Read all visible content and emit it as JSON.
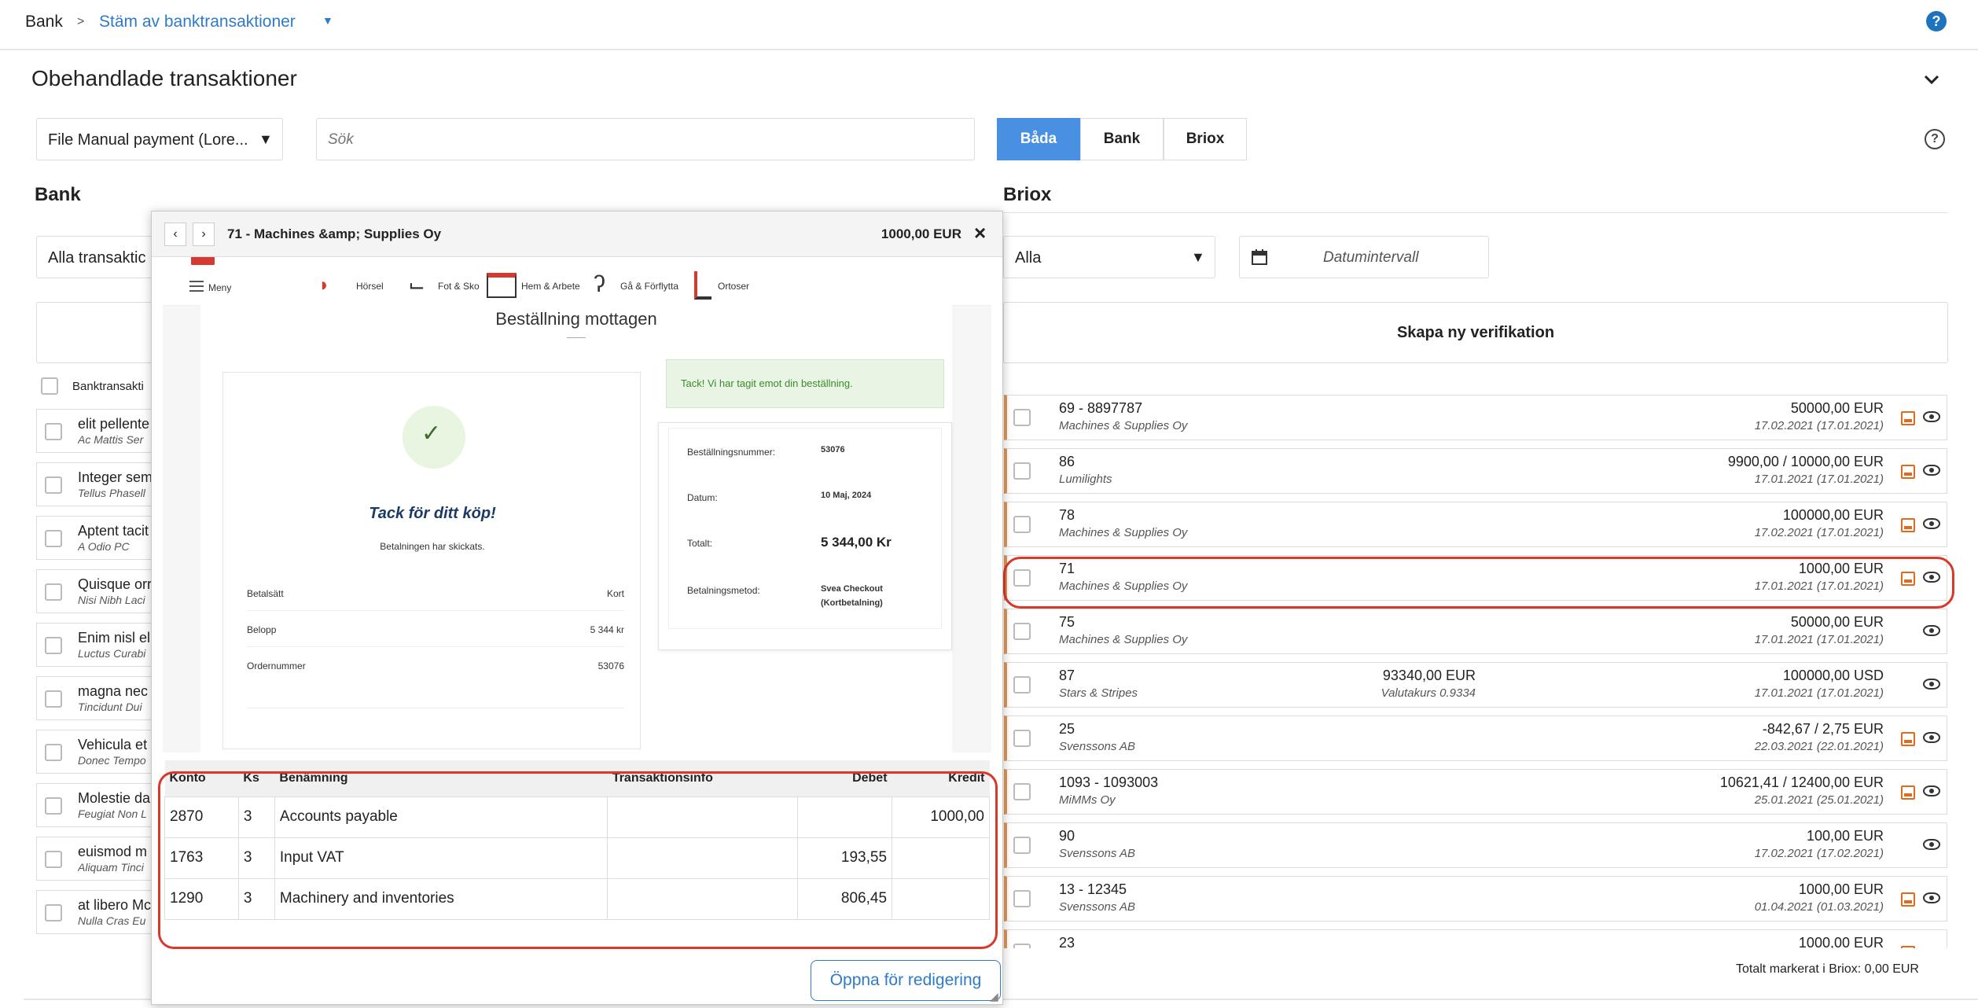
{
  "breadcrumb": {
    "root": "Bank",
    "separator": ">",
    "current": "Stäm av banktransaktioner"
  },
  "section": {
    "title": "Obehandlade transaktioner"
  },
  "filter": {
    "file_value": "File Manual payment (Lore...",
    "search_placeholder": "Sök"
  },
  "segments": [
    {
      "label": "Båda",
      "active": true
    },
    {
      "label": "Bank",
      "active": false
    },
    {
      "label": "Briox",
      "active": false
    }
  ],
  "bank": {
    "title": "Bank",
    "filter_value": "Alla transaktic",
    "column_header": "Banktransakti",
    "rows": [
      {
        "title": "elit pellente",
        "sub": "Ac Mattis Ser"
      },
      {
        "title": "Integer sem",
        "sub": "Tellus Phasell"
      },
      {
        "title": "Aptent tacit",
        "sub": "A Odio PC"
      },
      {
        "title": "Quisque orr",
        "sub": "Nisi Nibh Laci"
      },
      {
        "title": "Enim nisl el",
        "sub": "Luctus Curabi"
      },
      {
        "title": "magna nec",
        "sub": "Tincidunt Dui"
      },
      {
        "title": "Vehicula et",
        "sub": "Donec Tempo"
      },
      {
        "title": "Molestie da",
        "sub": "Feugiat Non L"
      },
      {
        "title": "euismod m",
        "sub": "Aliquam Tinci"
      },
      {
        "title": "at libero Mc",
        "sub": "Nulla Cras Eu"
      }
    ]
  },
  "briox": {
    "title": "Briox",
    "filter_value": "Alla",
    "date_placeholder": "Datumintervall",
    "create_button": "Skapa ny verifikation",
    "total_label": "Totalt markerat i Briox: 0,00 EUR",
    "rows": [
      {
        "title": "69 - 8897787",
        "sub": "Machines & Supplies Oy",
        "amount": "50000,00 EUR",
        "date": "17.02.2021 (17.01.2021)",
        "mid_amount": "",
        "mid_sub": "",
        "has_image": true
      },
      {
        "title": "86",
        "sub": "Lumilights",
        "amount": "9900,00 / 10000,00 EUR",
        "date": "17.01.2021 (17.01.2021)",
        "mid_amount": "",
        "mid_sub": "",
        "has_image": true
      },
      {
        "title": "78",
        "sub": "Machines & Supplies Oy",
        "amount": "100000,00 EUR",
        "date": "17.02.2021 (17.01.2021)",
        "mid_amount": "",
        "mid_sub": "",
        "has_image": true
      },
      {
        "title": "71",
        "sub": "Machines & Supplies Oy",
        "amount": "1000,00 EUR",
        "date": "17.01.2021 (17.01.2021)",
        "mid_amount": "",
        "mid_sub": "",
        "has_image": true
      },
      {
        "title": "75",
        "sub": "Machines & Supplies Oy",
        "amount": "50000,00 EUR",
        "date": "17.01.2021 (17.01.2021)",
        "mid_amount": "",
        "mid_sub": "",
        "has_image": false
      },
      {
        "title": "87",
        "sub": "Stars & Stripes",
        "amount": "100000,00 USD",
        "date": "17.01.2021 (17.01.2021)",
        "mid_amount": "93340,00 EUR",
        "mid_sub": "Valutakurs 0.9334",
        "has_image": true
      },
      {
        "title": "25",
        "sub": "Svenssons AB",
        "amount": "-842,67 / 2,75 EUR",
        "date": "22.03.2021 (22.01.2021)",
        "mid_amount": "",
        "mid_sub": "",
        "has_image": true
      },
      {
        "title": "1093 - 1093003",
        "sub": "MiMMs Oy",
        "amount": "10621,41 / 12400,00 EUR",
        "date": "25.01.2021 (25.01.2021)",
        "mid_amount": "",
        "mid_sub": "",
        "has_image": true
      },
      {
        "title": "90",
        "sub": "Svenssons AB",
        "amount": "100,00 EUR",
        "date": "17.02.2021 (17.02.2021)",
        "mid_amount": "",
        "mid_sub": "",
        "has_image": false
      },
      {
        "title": "13 - 12345",
        "sub": "Svenssons AB",
        "amount": "1000,00 EUR",
        "date": "01.04.2021 (01.03.2021)",
        "mid_amount": "",
        "mid_sub": "",
        "has_image": true
      },
      {
        "title": "23",
        "sub": "",
        "amount": "1000,00 EUR",
        "date": "",
        "mid_amount": "",
        "mid_sub": "",
        "has_image": true
      }
    ]
  },
  "popup": {
    "title": "71 - Machines &amp; Supplies Oy",
    "amount": "1000,00 EUR",
    "close_glyph": "×",
    "prev_glyph": "‹",
    "next_glyph": "›",
    "preview": {
      "nav": {
        "menu": "Meny",
        "items": [
          "Hörsel",
          "Fot & Sko",
          "Hem & Arbete",
          "Gå & Förflytta",
          "Ortoser"
        ]
      },
      "heading": "Beställning mottagen",
      "thanks_banner": "Tack! Vi har tagit emot din beställning.",
      "thanks_title": "Tack för ditt köp!",
      "thanks_sub": "Betalningen har skickats.",
      "payment": [
        {
          "label": "Betalsätt",
          "value": "Kort"
        },
        {
          "label": "Belopp",
          "value": "5 344 kr"
        },
        {
          "label": "Ordernummer",
          "value": "53076"
        }
      ],
      "order": [
        {
          "label": "Beställningsnummer:",
          "value": "53076"
        },
        {
          "label": "Datum:",
          "value": "10 Maj, 2024"
        },
        {
          "label": "Totalt:",
          "value": "5 344,00 Kr"
        },
        {
          "label": "Betalningsmetod:",
          "value": "Svea Checkout (Kortbetalning)"
        }
      ]
    },
    "table": {
      "headers": {
        "konto": "Konto",
        "ks": "Ks",
        "name": "Benämning",
        "info": "Transaktionsinfo",
        "debet": "Debet",
        "kredit": "Kredit"
      },
      "rows": [
        {
          "konto": "2870",
          "ks": "3",
          "name": "Accounts payable",
          "info": "",
          "debet": "",
          "kredit": "1000,00"
        },
        {
          "konto": "1763",
          "ks": "3",
          "name": "Input VAT",
          "info": "",
          "debet": "193,55",
          "kredit": ""
        },
        {
          "konto": "1290",
          "ks": "3",
          "name": "Machinery and inventories",
          "info": "",
          "debet": "806,45",
          "kredit": ""
        }
      ]
    },
    "edit_button": "Öppna för redigering"
  },
  "icons": {
    "help": "?",
    "collapse": "chevron-down-icon",
    "dropdown": "▼"
  },
  "colors": {
    "accent": "#4a90e2",
    "link": "#2d7bc9",
    "highlight": "#d9392a",
    "row_marker": "#e39450",
    "image_icon": "#e36a1c"
  }
}
